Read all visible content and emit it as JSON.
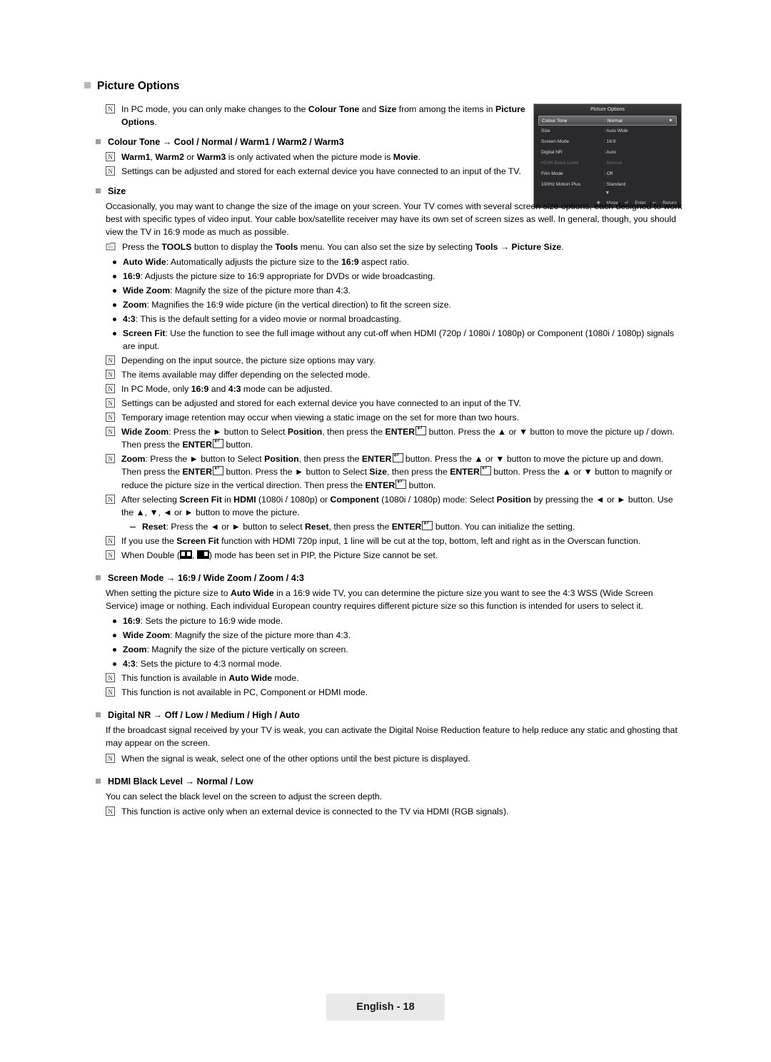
{
  "section": {
    "title": "Picture Options"
  },
  "notes": {
    "pc_mode": "In PC mode, you can only make changes to the Colour Tone and Size from among the items in Picture Options."
  },
  "colour_tone": {
    "heading": "Colour Tone → Cool / Normal / Warm1 / Warm2 / Warm3",
    "note1": "Warm1, Warm2 or Warm3 is only activated when the picture mode is Movie.",
    "note2": "Settings can be adjusted and stored for each external device you have connected to an input of the TV."
  },
  "size": {
    "heading": "Size",
    "para1": "Occasionally, you may want to change the size of the image on your screen. Your TV comes with several screen size options, each designed to work best with specific types of video input. Your cable box/satellite receiver may have its own set of screen sizes as well. In general, though, you should view the TV in 16:9 mode as much as possible.",
    "tools_note": "Press the TOOLS button to display the Tools menu. You can also set the size by selecting Tools → Picture Size.",
    "bullets": [
      "Auto Wide: Automatically adjusts the picture size to the 16:9 aspect ratio.",
      "16:9: Adjusts the picture size to 16:9 appropriate for DVDs or wide broadcasting.",
      "Wide Zoom: Magnify the size of the picture more than 4:3.",
      "Zoom: Magnifies the 16:9 wide picture (in the vertical direction) to fit the screen size.",
      "4:3: This is the default setting for a video movie or normal broadcasting.",
      "Screen Fit: Use the function to see the full image without any cut-off when HDMI (720p / 1080i / 1080p) or Component (1080i / 1080p) signals are input."
    ],
    "notes": [
      "Depending on the input source, the picture size options may vary.",
      "The items available may differ depending on the selected mode.",
      "In PC Mode, only 16:9 and 4:3 mode can be adjusted.",
      "Settings can be adjusted and stored for each external device you have connected to an input of the TV.",
      "Temporary image retention may occur when viewing a static image on the set for more than two hours.",
      "Wide Zoom: Press the ► button to Select Position, then press the ENTER button. Press the ▲ or ▼ button to move the picture up / down. Then press the ENTER button.",
      "Zoom: Press the ► button to Select Position, then press the ENTER button. Press the ▲ or ▼ button to move the picture up and down. Then press the ENTER button. Press the ► button to Select Size, then press the ENTER button. Press the ▲ or ▼ button to magnify or reduce the picture size in the vertical direction. Then press the ENTER button.",
      "After selecting Screen Fit in HDMI (1080i / 1080p) or Component (1080i / 1080p) mode: Select Position by pressing the ◄ or ► button. Use the ▲, ▼, ◄ or ► button to move the picture.",
      "If you use the Screen Fit function with HDMI 720p input, 1 line will be cut at the top, bottom, left and right as in the Overscan function.",
      "When Double ( , ) mode has been set in PIP, the Picture Size cannot be set."
    ],
    "reset_note": "Reset: Press the ◄ or ► button to select Reset, then press the ENTER button. You can initialize the setting."
  },
  "screen_mode": {
    "heading": "Screen Mode → 16:9 / Wide Zoom / Zoom / 4:3",
    "para": "When setting the picture size to Auto Wide in a 16:9 wide TV, you can determine the picture size you want to see the 4:3 WSS (Wide Screen Service) image or nothing. Each individual European country requires different picture size so this function is intended for users to select it.",
    "bullets": [
      "16:9: Sets the picture to 16:9 wide mode.",
      "Wide Zoom: Magnify the size of the picture more than 4:3.",
      "Zoom: Magnify the size of the picture vertically on screen.",
      "4:3: Sets the picture to 4:3 normal mode."
    ],
    "notes": [
      "This function is available in Auto Wide mode.",
      "This function is not available in PC, Component or HDMI mode."
    ]
  },
  "digital_nr": {
    "heading": "Digital NR → Off / Low / Medium / High / Auto",
    "para": "If the broadcast signal received by your TV is weak, you can activate the Digital Noise Reduction feature to help reduce any static and ghosting that may appear on the screen.",
    "note": "When the signal is weak, select one of the other options until the best picture is displayed."
  },
  "hdmi_black": {
    "heading": "HDMI Black Level → Normal / Low",
    "para": "You can select the black level on the screen to adjust the screen depth.",
    "note": "This function is active only when an external device is connected to the TV via HDMI (RGB signals)."
  },
  "osd": {
    "title": "Picture Options",
    "rows": [
      {
        "label": "Colour Tone",
        "value": ": Normal",
        "state": "selected"
      },
      {
        "label": "Size",
        "value": ": Auto Wide",
        "state": "normal"
      },
      {
        "label": "Screen Mode",
        "value": ": 16:9",
        "state": "normal"
      },
      {
        "label": "Digital NR",
        "value": ": Auto",
        "state": "normal"
      },
      {
        "label": "HDMI Black Level",
        "value": ": Normal",
        "state": "dimmed"
      },
      {
        "label": "Film Mode",
        "value": ": Off",
        "state": "normal"
      },
      {
        "label": "100Hz Motion Plus",
        "value": ": Standard",
        "state": "normal"
      }
    ],
    "scroll_down": "▼",
    "footer": {
      "move": "Move",
      "enter": "Enter",
      "return": "Return"
    }
  },
  "footer": {
    "page_label": "English - 18"
  }
}
